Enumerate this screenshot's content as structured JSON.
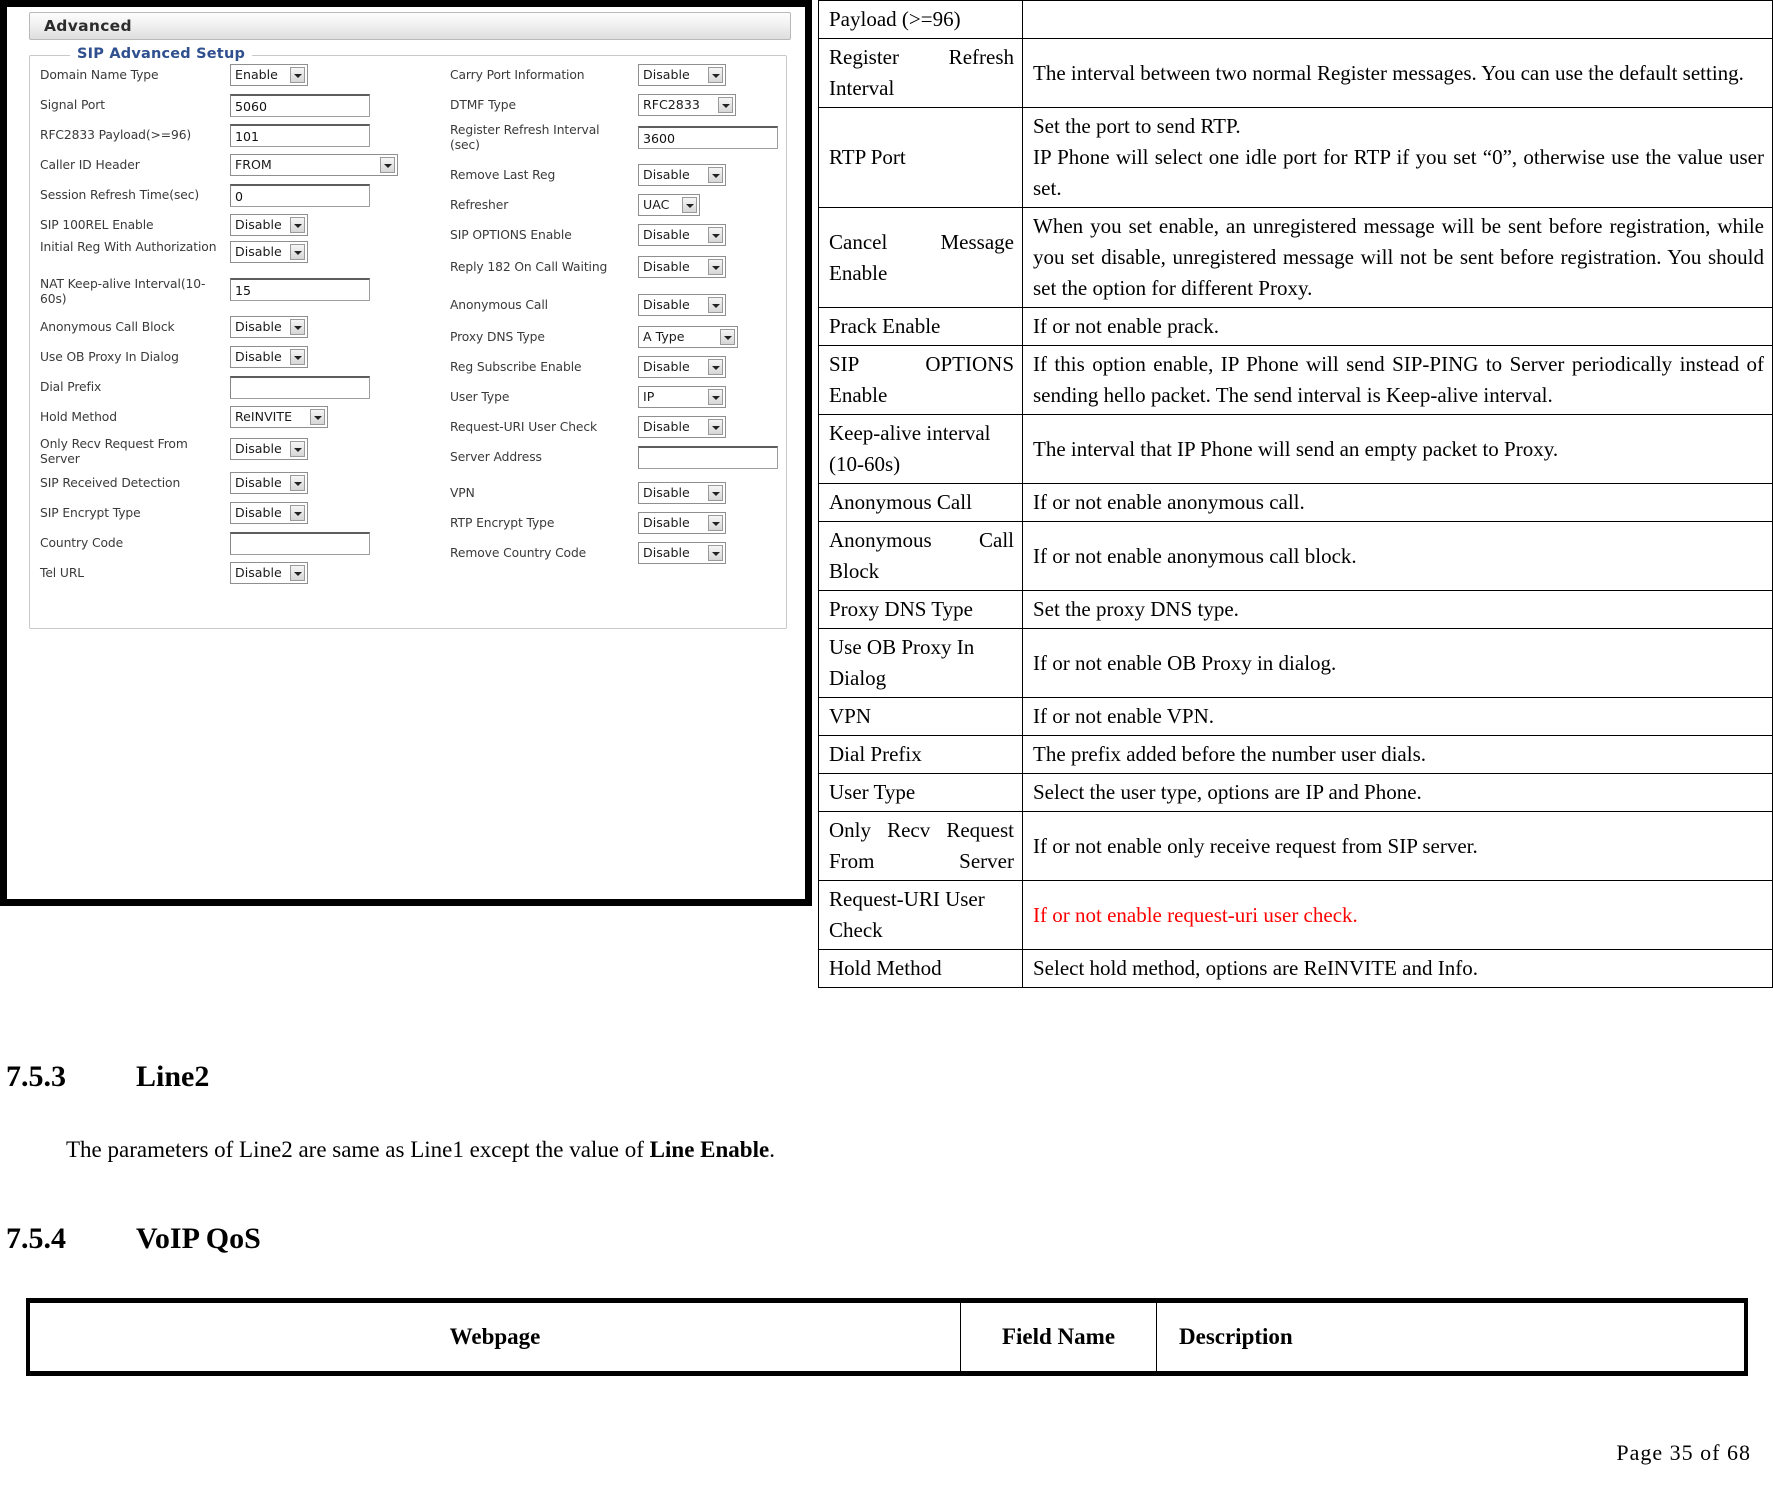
{
  "screenshot": {
    "window_title": "Advanced",
    "fieldset_legend": "SIP Advanced Setup",
    "left_fields": [
      {
        "label": "Domain Name Type",
        "type": "select",
        "value": "Enable"
      },
      {
        "label": "Signal Port",
        "type": "text",
        "value": "5060"
      },
      {
        "label": "RFC2833 Payload(>=96)",
        "type": "text",
        "value": "101"
      },
      {
        "label": "Caller ID Header",
        "type": "select",
        "value": "FROM"
      },
      {
        "label": "Session Refresh Time(sec)",
        "type": "text",
        "value": "0"
      },
      {
        "label": "SIP 100REL Enable",
        "type": "select",
        "value": "Disable"
      },
      {
        "label": "Initial Reg With Authorization",
        "type": "select",
        "value": "Disable"
      },
      {
        "label": "NAT Keep-alive Interval(10-60s)",
        "type": "text",
        "value": "15"
      },
      {
        "label": "Anonymous Call Block",
        "type": "select",
        "value": "Disable"
      },
      {
        "label": "Use OB Proxy In Dialog",
        "type": "select",
        "value": "Disable"
      },
      {
        "label": "Dial Prefix",
        "type": "text",
        "value": ""
      },
      {
        "label": "Hold Method",
        "type": "select",
        "value": "ReINVITE"
      },
      {
        "label": "Only Recv Request From Server",
        "type": "select",
        "value": "Disable"
      },
      {
        "label": "SIP Received Detection",
        "type": "select",
        "value": "Disable"
      },
      {
        "label": "SIP Encrypt Type",
        "type": "select",
        "value": "Disable"
      },
      {
        "label": "Country Code",
        "type": "text",
        "value": ""
      },
      {
        "label": "Tel URL",
        "type": "select",
        "value": "Disable"
      }
    ],
    "right_fields": [
      {
        "label": "Carry Port Information",
        "type": "select",
        "value": "Disable"
      },
      {
        "label": "DTMF Type",
        "type": "select",
        "value": "RFC2833"
      },
      {
        "label": "Register Refresh Interval (sec)",
        "type": "text",
        "value": "3600"
      },
      {
        "label": "Remove Last Reg",
        "type": "select",
        "value": "Disable"
      },
      {
        "label": "Refresher",
        "type": "select",
        "value": "UAC"
      },
      {
        "label": "SIP OPTIONS Enable",
        "type": "select",
        "value": "Disable"
      },
      {
        "label": "Reply 182 On Call Waiting",
        "type": "select",
        "value": "Disable"
      },
      {
        "label": "Anonymous Call",
        "type": "select",
        "value": "Disable"
      },
      {
        "label": "Proxy DNS Type",
        "type": "select",
        "value": "A Type"
      },
      {
        "label": "Reg Subscribe Enable",
        "type": "select",
        "value": "Disable"
      },
      {
        "label": "User Type",
        "type": "select",
        "value": "IP"
      },
      {
        "label": "Request-URI User Check",
        "type": "select",
        "value": "Disable"
      },
      {
        "label": "Server Address",
        "type": "text",
        "value": ""
      },
      {
        "label": "VPN",
        "type": "select",
        "value": "Disable"
      },
      {
        "label": "RTP Encrypt Type",
        "type": "select",
        "value": "Disable"
      },
      {
        "label": "Remove Country Code",
        "type": "select",
        "value": "Disable"
      }
    ]
  },
  "description_table": {
    "rows": [
      {
        "name": "Payload (>=96)",
        "name_justify": false,
        "lines": []
      },
      {
        "name": "Register Refresh Interval",
        "name_justify": true,
        "lines": [
          "The interval between two normal Register messages. You can use the default setting."
        ]
      },
      {
        "name": "RTP Port",
        "name_justify": false,
        "lines": [
          "Set the port to send RTP.",
          "IP Phone will select one idle port for RTP if you set “0”, otherwise use the value user set."
        ]
      },
      {
        "name": "Cancel Message Enable",
        "name_justify": true,
        "lines": [
          "When you set enable, an unregistered message will be sent before registration, while you set disable, unregistered message will not be sent before registration. You should set the option for different Proxy."
        ]
      },
      {
        "name": "Prack Enable",
        "name_justify": false,
        "lines": [
          "If or not enable prack."
        ]
      },
      {
        "name": "SIP OPTIONS Enable",
        "name_justify": true,
        "lines": [
          "If this option enable, IP Phone will send SIP-PING to Server periodically instead of sending hello packet. The send interval is Keep-alive interval."
        ]
      },
      {
        "name": "Keep-alive interval (10-60s)",
        "name_justify": false,
        "lines": [
          "The interval that IP Phone will send an empty packet to Proxy."
        ]
      },
      {
        "name": "Anonymous Call",
        "name_justify": false,
        "lines": [
          "If or not enable anonymous call."
        ]
      },
      {
        "name": "Anonymous Call Block",
        "name_justify": true,
        "lines": [
          "If or not enable anonymous call block."
        ]
      },
      {
        "name": "Proxy DNS Type",
        "name_justify": false,
        "lines": [
          "Set the proxy DNS type."
        ]
      },
      {
        "name": "Use OB Proxy In Dialog",
        "name_justify": false,
        "lines": [
          "If or not enable OB Proxy in dialog."
        ]
      },
      {
        "name": "VPN",
        "name_justify": false,
        "lines": [
          "If or not enable VPN."
        ]
      },
      {
        "name": "Dial Prefix",
        "name_justify": false,
        "lines": [
          "The prefix added before the number user dials."
        ]
      },
      {
        "name": "User Type",
        "name_justify": false,
        "lines": [
          "Select the user type, options are IP and Phone."
        ]
      },
      {
        "name": "Only Recv Request From Server",
        "name_justify": true,
        "lines": [
          "If or not enable only receive request from SIP server."
        ]
      },
      {
        "name": "Request-URI User Check",
        "name_justify": false,
        "red": true,
        "lines": [
          "If or not enable request-uri user check."
        ]
      },
      {
        "name": "Hold Method",
        "name_justify": false,
        "lines": [
          "Select hold method, options are ReINVITE and Info."
        ]
      }
    ]
  },
  "sections": {
    "line2": {
      "number": "7.5.3",
      "title": "Line2",
      "paragraph_before": "The parameters of Line2 are same as Line1 except the value of ",
      "paragraph_bold": "Line Enable",
      "paragraph_after": "."
    },
    "voip_qos": {
      "number": "7.5.4",
      "title": "VoIP QoS"
    }
  },
  "qos_table": {
    "headers": [
      "Webpage",
      "Field Name",
      "Description"
    ]
  },
  "footer": {
    "text": "Page  35  of  68"
  },
  "colors": {
    "red_note": "#ff0000",
    "legend_blue": "#2f4f8f",
    "frame_black": "#000000"
  }
}
